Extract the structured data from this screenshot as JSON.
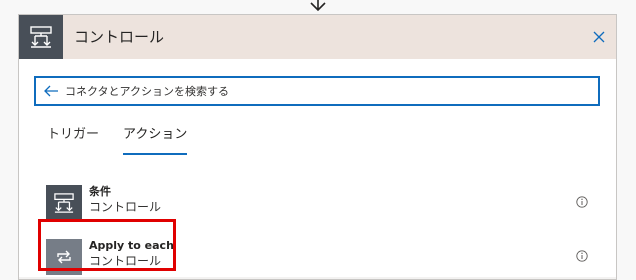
{
  "panel": {
    "title": "コントロール",
    "header_bg": "#ede3dd",
    "icon_bg": "#484f58"
  },
  "search": {
    "placeholder": "コネクタとアクションを検索する"
  },
  "tabs": [
    {
      "label": "トリガー",
      "active": false
    },
    {
      "label": "アクション",
      "active": true
    }
  ],
  "actions": [
    {
      "name": "条件",
      "connector": "コントロール",
      "icon": "condition-icon",
      "icon_bg": "#484f58"
    },
    {
      "name": "Apply to each",
      "connector": "コントロール",
      "icon": "loop-icon",
      "icon_bg": "#767d87"
    }
  ],
  "colors": {
    "accent": "#0f6cbd",
    "highlight": "#e00000"
  }
}
